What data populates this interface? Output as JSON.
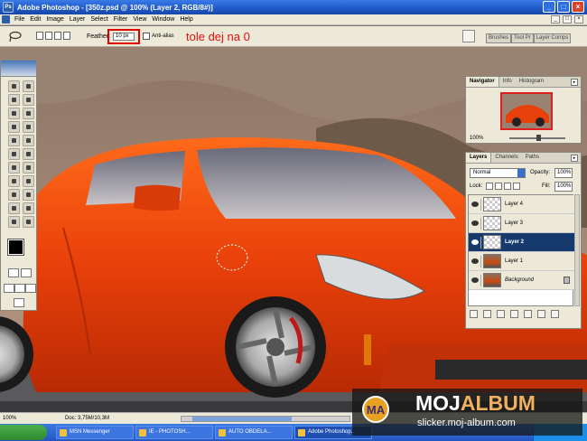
{
  "titlebar": {
    "app_icon": "Ps",
    "title": "Adobe Photoshop - [350z.psd @ 100% (Layer 2, RGB/8#)]",
    "buttons": [
      "_",
      "□",
      "×"
    ]
  },
  "menubar": {
    "items": [
      "File",
      "Edit",
      "Image",
      "Layer",
      "Select",
      "Filter",
      "View",
      "Window",
      "Help"
    ],
    "doc_buttons": [
      "_",
      "□",
      "×"
    ]
  },
  "options": {
    "tool_icon": "lasso-icon",
    "feather_label": "Feather:",
    "feather_value": "10 px",
    "antialias_label": "Anti-alias",
    "annotation": "tole dej na 0",
    "well_tabs": [
      "Brushes",
      "Tool Pr",
      "Layer Comps"
    ]
  },
  "navigator": {
    "tabs": [
      "Navigator",
      "Info",
      "Histogram"
    ],
    "zoom": "100%"
  },
  "layers_panel": {
    "tabs": [
      "Layers",
      "Channels",
      "Paths"
    ],
    "blend_mode": "Normal",
    "opacity_label": "Opacity:",
    "opacity": "100%",
    "lock_label": "Lock:",
    "fill_label": "Fill:",
    "fill": "100%",
    "layers": [
      {
        "name": "Layer 4",
        "selected": false,
        "thumb": "transparent"
      },
      {
        "name": "Layer 3",
        "selected": false,
        "thumb": "transparent"
      },
      {
        "name": "Layer 2",
        "selected": true,
        "thumb": "transparent"
      },
      {
        "name": "Layer 1",
        "selected": false,
        "thumb": "car"
      },
      {
        "name": "Background",
        "selected": false,
        "thumb": "car",
        "locked": true
      }
    ]
  },
  "statusbar": {
    "zoom": "100%",
    "doc": "Doc: 3,75M/10,3M"
  },
  "taskbar": {
    "buttons": [
      "MSN Messenger",
      "IE - PHOTOSH...",
      "AUTO OBDELA...",
      "Adobe Photoshop..."
    ]
  },
  "watermark": {
    "logo": "MA",
    "title_a": "MOJ",
    "title_b": "ALBUM",
    "url": "slicker.moj-album.com"
  },
  "colors": {
    "accent": "#e00000",
    "car": "#e8400a",
    "selected_layer": "#163a6b"
  }
}
